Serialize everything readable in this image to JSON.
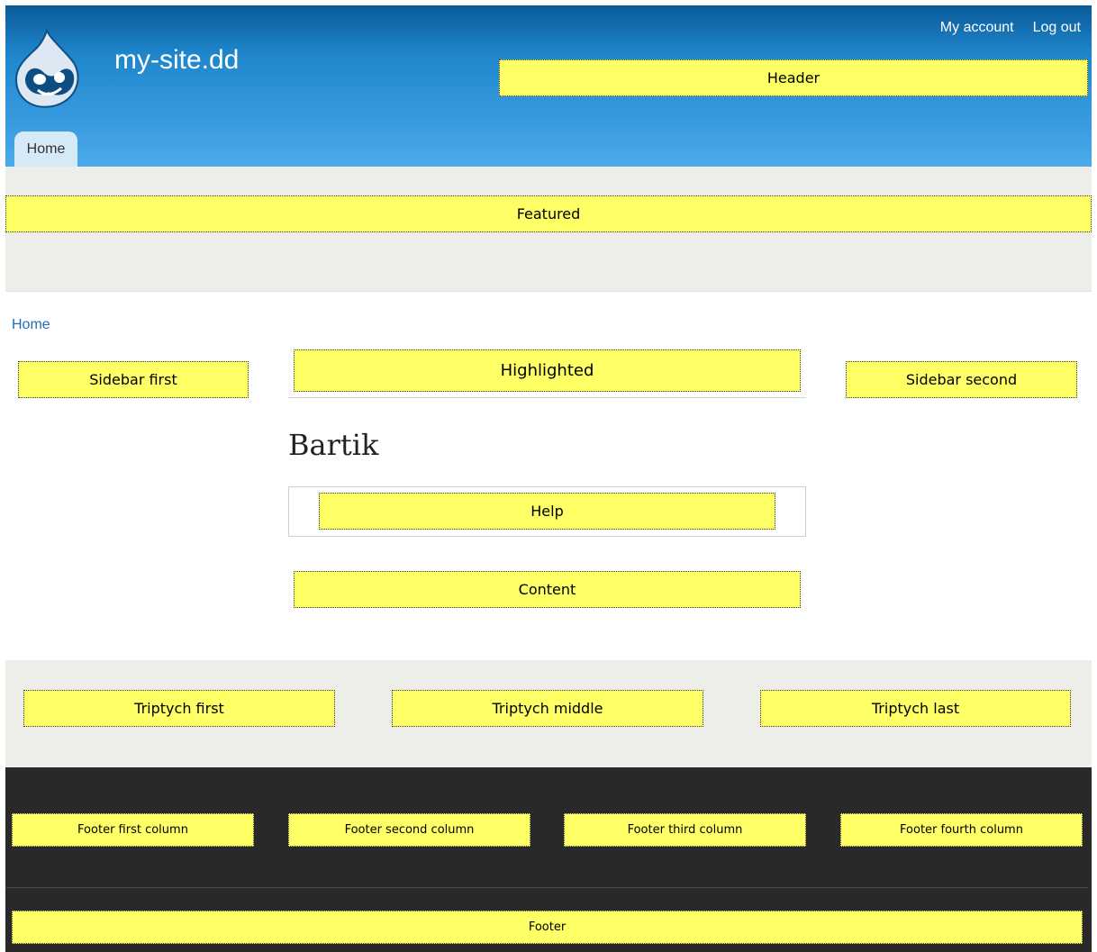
{
  "header": {
    "site_name": "my-site.dd",
    "secondary_menu": [
      "My account",
      "Log out"
    ],
    "main_tab": "Home",
    "region_label": "Header"
  },
  "featured": {
    "label": "Featured"
  },
  "breadcrumb": {
    "home": "Home"
  },
  "regions": {
    "sidebar_first": "Sidebar first",
    "highlighted": "Highlighted",
    "sidebar_second": "Sidebar second",
    "help": "Help",
    "content": "Content"
  },
  "page": {
    "title": "Bartik"
  },
  "triptych": {
    "first": "Triptych first",
    "middle": "Triptych middle",
    "last": "Triptych last"
  },
  "footer": {
    "first": "Footer first column",
    "second": "Footer second column",
    "third": "Footer third column",
    "fourth": "Footer fourth column",
    "footer": "Footer"
  },
  "colors": {
    "region_fill": "#ffff66",
    "header_top": "#0a5a98",
    "header_bottom": "#4caaea",
    "link": "#1b73bb",
    "band_light": "#edeeea",
    "footer_dark": "#292929"
  },
  "icons": {
    "logo": "drupal-drop-logo-icon"
  }
}
